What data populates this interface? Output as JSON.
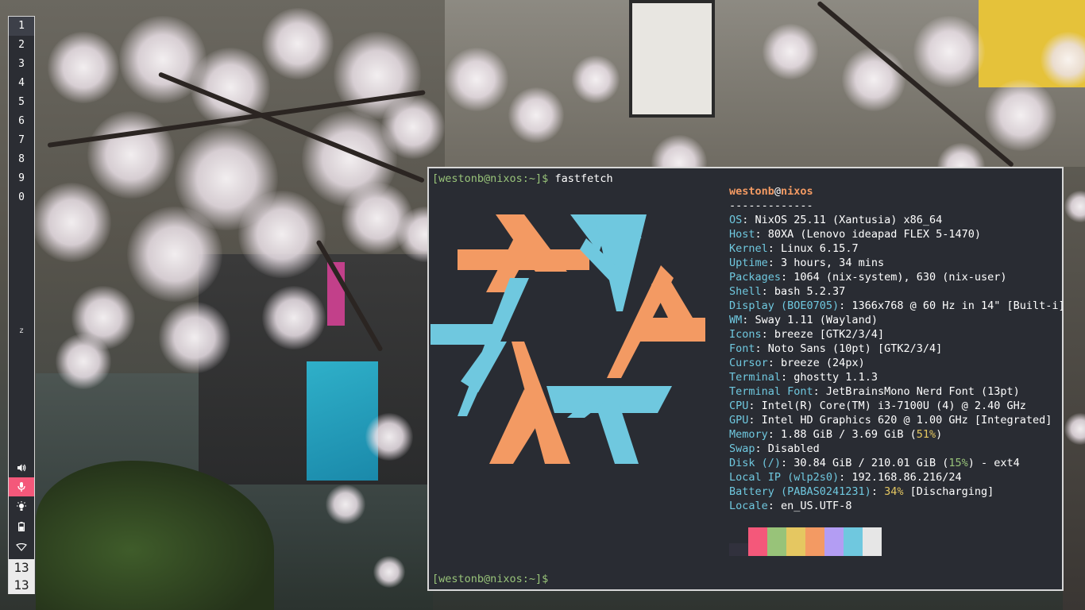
{
  "colors": {
    "blue": "#6fc8df",
    "orange": "#f39a63",
    "prompt_green": "#98c379",
    "yellow": "#e5c761",
    "terminal_bg": "#292c33",
    "bar_bg": "#2b2d33",
    "mic_active": "#f4587a"
  },
  "sidebar": {
    "workspaces": [
      "1",
      "2",
      "3",
      "4",
      "5",
      "6",
      "7",
      "8",
      "9",
      "0"
    ],
    "active_workspace": "1",
    "sleep_indicator": "z",
    "tray_icons": [
      "volume-icon",
      "microphone-icon",
      "brightness-icon",
      "battery-icon",
      "wifi-icon"
    ],
    "clock": {
      "hour": "13",
      "minute": "13"
    }
  },
  "terminal": {
    "prompt": "[westonb@nixos:~]$",
    "command": "fastfetch",
    "user": "westonb",
    "at": "@",
    "host": "nixos",
    "separator": "-------------",
    "info": [
      {
        "key": "OS",
        "value": ": NixOS 25.11 (Xantusia) x86_64"
      },
      {
        "key": "Host",
        "value": ": 80XA (Lenovo ideapad FLEX 5-1470)"
      },
      {
        "key": "Kernel",
        "value": ": Linux 6.15.7"
      },
      {
        "key": "Uptime",
        "value": ": 3 hours, 34 mins"
      },
      {
        "key": "Packages",
        "value": ": 1064 (nix-system), 630 (nix-user)"
      },
      {
        "key": "Shell",
        "value": ": bash 5.2.37"
      },
      {
        "key": "Display (BOE0705)",
        "value": ": 1366x768 @ 60 Hz in 14\" [Built-i]"
      },
      {
        "key": "WM",
        "value": ": Sway 1.11 (Wayland)"
      },
      {
        "key": "Icons",
        "value": ": breeze [GTK2/3/4]"
      },
      {
        "key": "Font",
        "value": ": Noto Sans (10pt) [GTK2/3/4]"
      },
      {
        "key": "Cursor",
        "value": ": breeze (24px)"
      },
      {
        "key": "Terminal",
        "value": ": ghostty 1.1.3"
      },
      {
        "key": "Terminal Font",
        "value": ": JetBrainsMono Nerd Font (13pt)"
      },
      {
        "key": "CPU",
        "value": ": Intel(R) Core(TM) i3-7100U (4) @ 2.40 GHz"
      },
      {
        "key": "GPU",
        "value": ": Intel HD Graphics 620 @ 1.00 GHz [Integrated]"
      }
    ],
    "memory": {
      "key": "Memory",
      "pre": ": 1.88 GiB / 3.69 GiB (",
      "pct": "51%",
      "post": ")"
    },
    "swap": {
      "key": "Swap",
      "value": ": Disabled"
    },
    "disk": {
      "key": "Disk (/)",
      "pre": ": 30.84 GiB / 210.01 GiB (",
      "pct": "15%",
      "post": ") - ext4"
    },
    "local_ip": {
      "key": "Local IP (wlp2s0)",
      "value": ": 192.168.86.216/24"
    },
    "battery": {
      "key": "Battery (PABAS0241231)",
      "pre": ": ",
      "pct": "34%",
      "post": " [Discharging]"
    },
    "locale": {
      "key": "Locale",
      "value": ": en_US.UTF-8"
    },
    "palette": [
      "#31313d",
      "#f4587a",
      "#98c379",
      "#e5c761",
      "#f39a63",
      "#b39df3",
      "#6fc8df",
      "#e6e6e6"
    ]
  }
}
